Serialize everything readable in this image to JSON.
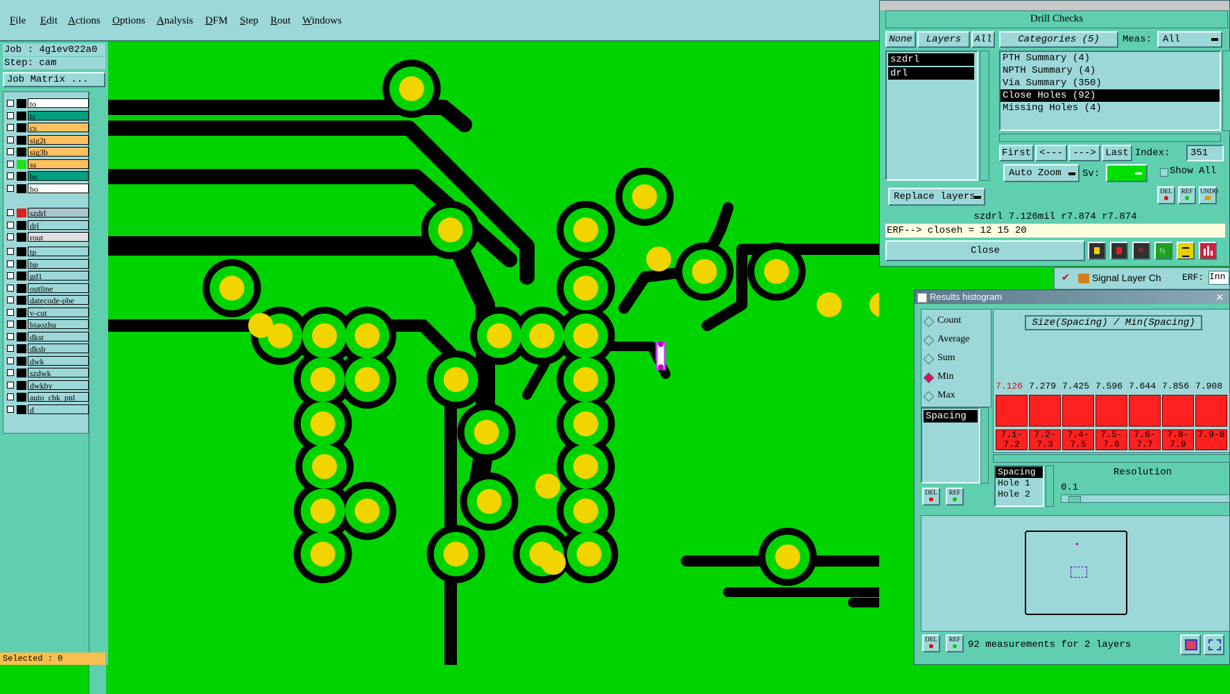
{
  "menu": [
    "File",
    "Edit",
    "Actions",
    "Options",
    "Analysis",
    "DFM",
    "Step",
    "Rout",
    "Windows"
  ],
  "job": {
    "job_label": "Job : 4g1ev022a0",
    "step_label": "Step: cam",
    "matrix_button": "Job Matrix ..."
  },
  "layers_group1": [
    "to",
    "ts",
    "cs",
    "sig2t",
    "sig3b",
    "ss",
    "bs",
    "bo"
  ],
  "layers_group2": [
    "szdrl",
    "drl",
    "rout"
  ],
  "layers_group3": [
    "tp",
    "bp",
    "gd1",
    "outline",
    "datecode-pbe",
    "v-cut",
    "biaozhu",
    "dkst",
    "dksb",
    "dwk",
    "szdwk",
    "dwkby",
    "auto_chk_pnl",
    "d"
  ],
  "status": {
    "selected": "Selected : 0"
  },
  "drill": {
    "title": "Drill Checks",
    "none": "None",
    "layers": "Layers",
    "all": "All",
    "categories_header": "Categories (5)",
    "meas_label": "Meas:",
    "meas_value": "All",
    "layer_list": [
      "szdrl",
      "drl"
    ],
    "categories": [
      "PTH Summary (4)",
      "NPTH Summary (4)",
      "Via Summary (350)",
      "Close Holes (92)",
      "Missing Holes (4)"
    ],
    "first": "First",
    "prev": "<---",
    "next": "--->",
    "last": "Last",
    "index_label": "Index:",
    "index_value": "351",
    "auto_zoom": "Auto Zoom",
    "sv_label": "Sv:",
    "show_all": "Show All",
    "replace_layers": "Replace layers",
    "del": "DEL",
    "ref": "REF",
    "undo": "UNDO",
    "info_line": "szdrl 7.126mil  r7.874  r7.874",
    "erf_line": "ERF--> closeh = 12 15 20",
    "close": "Close"
  },
  "signal_tab": {
    "label": "Signal Layer Ch",
    "erf": "ERF:",
    "field": "Inn"
  },
  "hist": {
    "title": "Results histogram",
    "modes": [
      "Count",
      "Average",
      "Sum",
      "Min",
      "Max"
    ],
    "selected_mode": "Min",
    "graph_title": "Size(Spacing) / Min(Spacing)",
    "values": [
      "7.126",
      "7.279",
      "7.425",
      "7.596",
      "7.644",
      "7.856",
      "7.908"
    ],
    "ranges": [
      "7.1-7.2",
      "7.2-7.3",
      "7.4-7.5",
      "7.5-7.6",
      "7.6-7.7",
      "7.8-7.9",
      "7.9-8"
    ],
    "left_list": [
      "Spacing"
    ],
    "attr_list": [
      "Spacing",
      "Hole 1",
      "Hole 2"
    ],
    "resolution_label": "Resolution",
    "resolution_value": "0.1",
    "del": "DEL",
    "ref": "REF",
    "footer": "92 measurements for 2 layers"
  },
  "colors": {
    "copper": "#00d400",
    "pad": "#f2d400",
    "gap": "#000000",
    "panel": "#5fcfb0",
    "widget": "#9dd8d8",
    "bar": "#ff2020"
  }
}
